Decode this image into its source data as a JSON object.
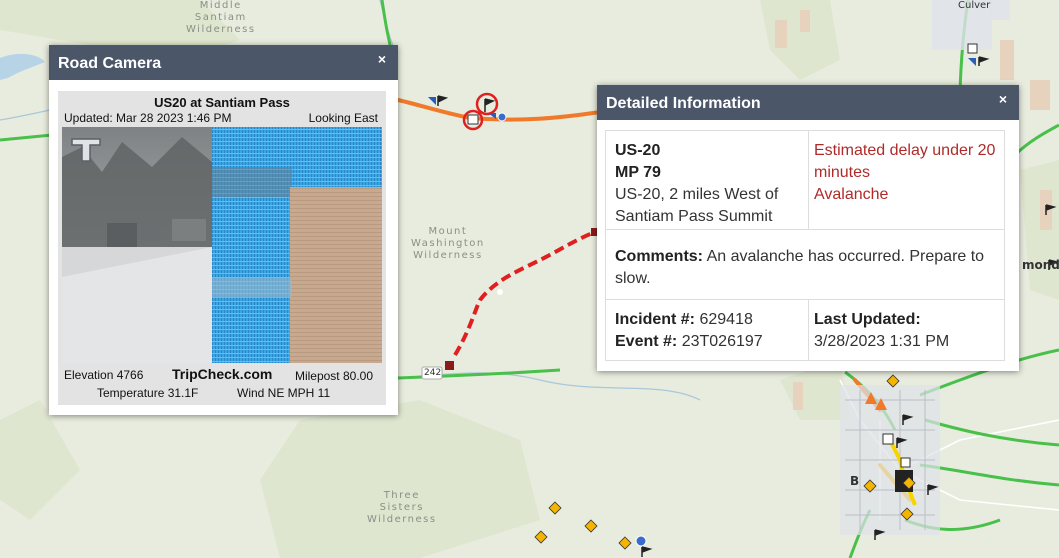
{
  "map": {
    "labels": {
      "middle_santiam": [
        "Middle",
        "Santiam",
        "Wilderness"
      ],
      "mount_washington": [
        "Mount",
        "Washington",
        "Wilderness"
      ],
      "three_sisters": [
        "Three",
        "Sisters",
        "Wilderness"
      ],
      "culver": "Culver",
      "redmond_partial": "mond",
      "bend_partial": "B",
      "route_242": "242"
    }
  },
  "camera_popup": {
    "title": "Road Camera",
    "close_label": "×",
    "camera_name": "US20 at Santiam Pass",
    "updated": "Updated: Mar 28 2023  1:46 PM",
    "direction": "Looking East",
    "elevation": "Elevation 4766",
    "brand": "TripCheck.com",
    "milepost": "Milepost  80.00",
    "temperature": "Temperature 31.1F",
    "wind": "Wind NE  MPH  11"
  },
  "info_popup": {
    "title": "Detailed Information",
    "close_label": "×",
    "route": "US-20",
    "milepost": "MP 79",
    "location": "US-20, 2 miles West of Santiam Pass Summit",
    "delay": "Estimated delay under 20 minutes",
    "event_type": "Avalanche",
    "comments_label": "Comments:",
    "comments": "An avalanche has occurred. Prepare to slow.",
    "incident_label": "Incident #:",
    "incident_number": "629418",
    "event_label": "Event #:",
    "event_number": "23T026197",
    "last_updated_label": "Last Updated:",
    "last_updated": "3/28/2023 1:31 PM"
  },
  "colors": {
    "header_bg": "#4b5769",
    "highway_green": "#49c04a",
    "congestion_orange": "#f07a2a",
    "closure_red": "#e02020",
    "alert_red_text": "#b02a2a",
    "warning_yellow": "#f5d400"
  }
}
